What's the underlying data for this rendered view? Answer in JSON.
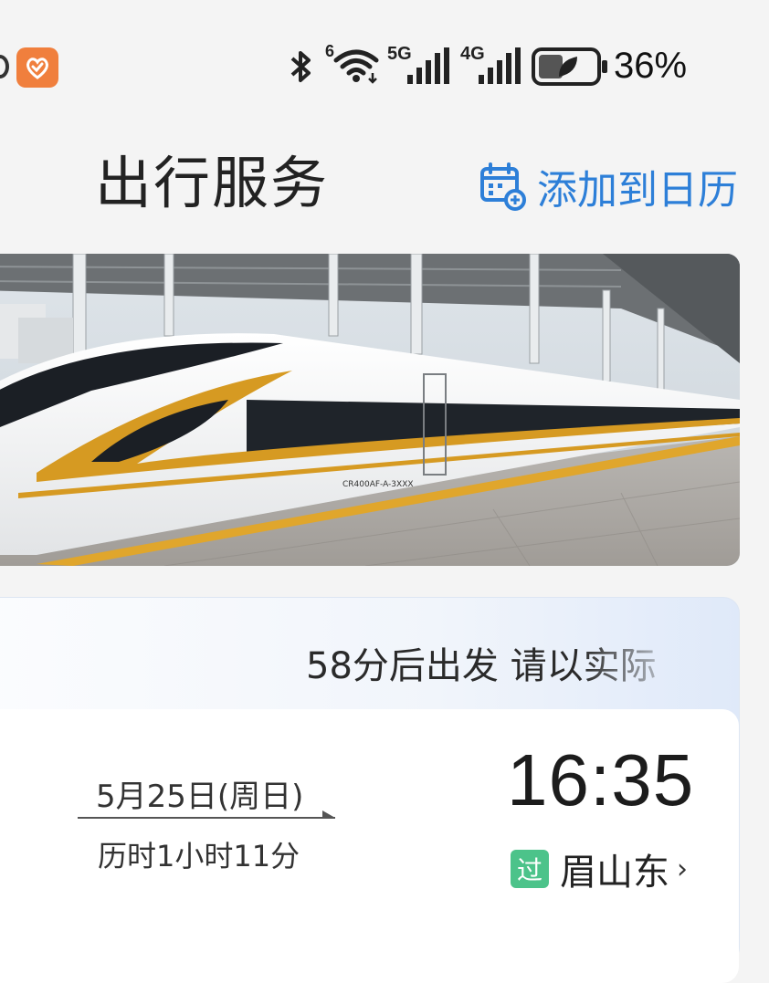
{
  "status_bar": {
    "battery": "36%",
    "signal_1": "5G",
    "signal_2": "4G",
    "wifi_badge": "6"
  },
  "header": {
    "title": "出行服务",
    "calendar_action": "添加到日历"
  },
  "banner": {
    "train_code": "CR400AF-A-3XXX"
  },
  "trip": {
    "departure_notice": "58分后出发 请以实际",
    "date": "5月25日(周日)",
    "duration": "历时1小时11分",
    "time": "16:35",
    "pass_badge": "过",
    "station": "眉山东",
    "chevron": "›"
  },
  "colors": {
    "accent": "#2d7fd8",
    "pass_badge": "#4cc38a",
    "train_stripe": "#e0a62c",
    "app_icon": "#f07f3d"
  }
}
